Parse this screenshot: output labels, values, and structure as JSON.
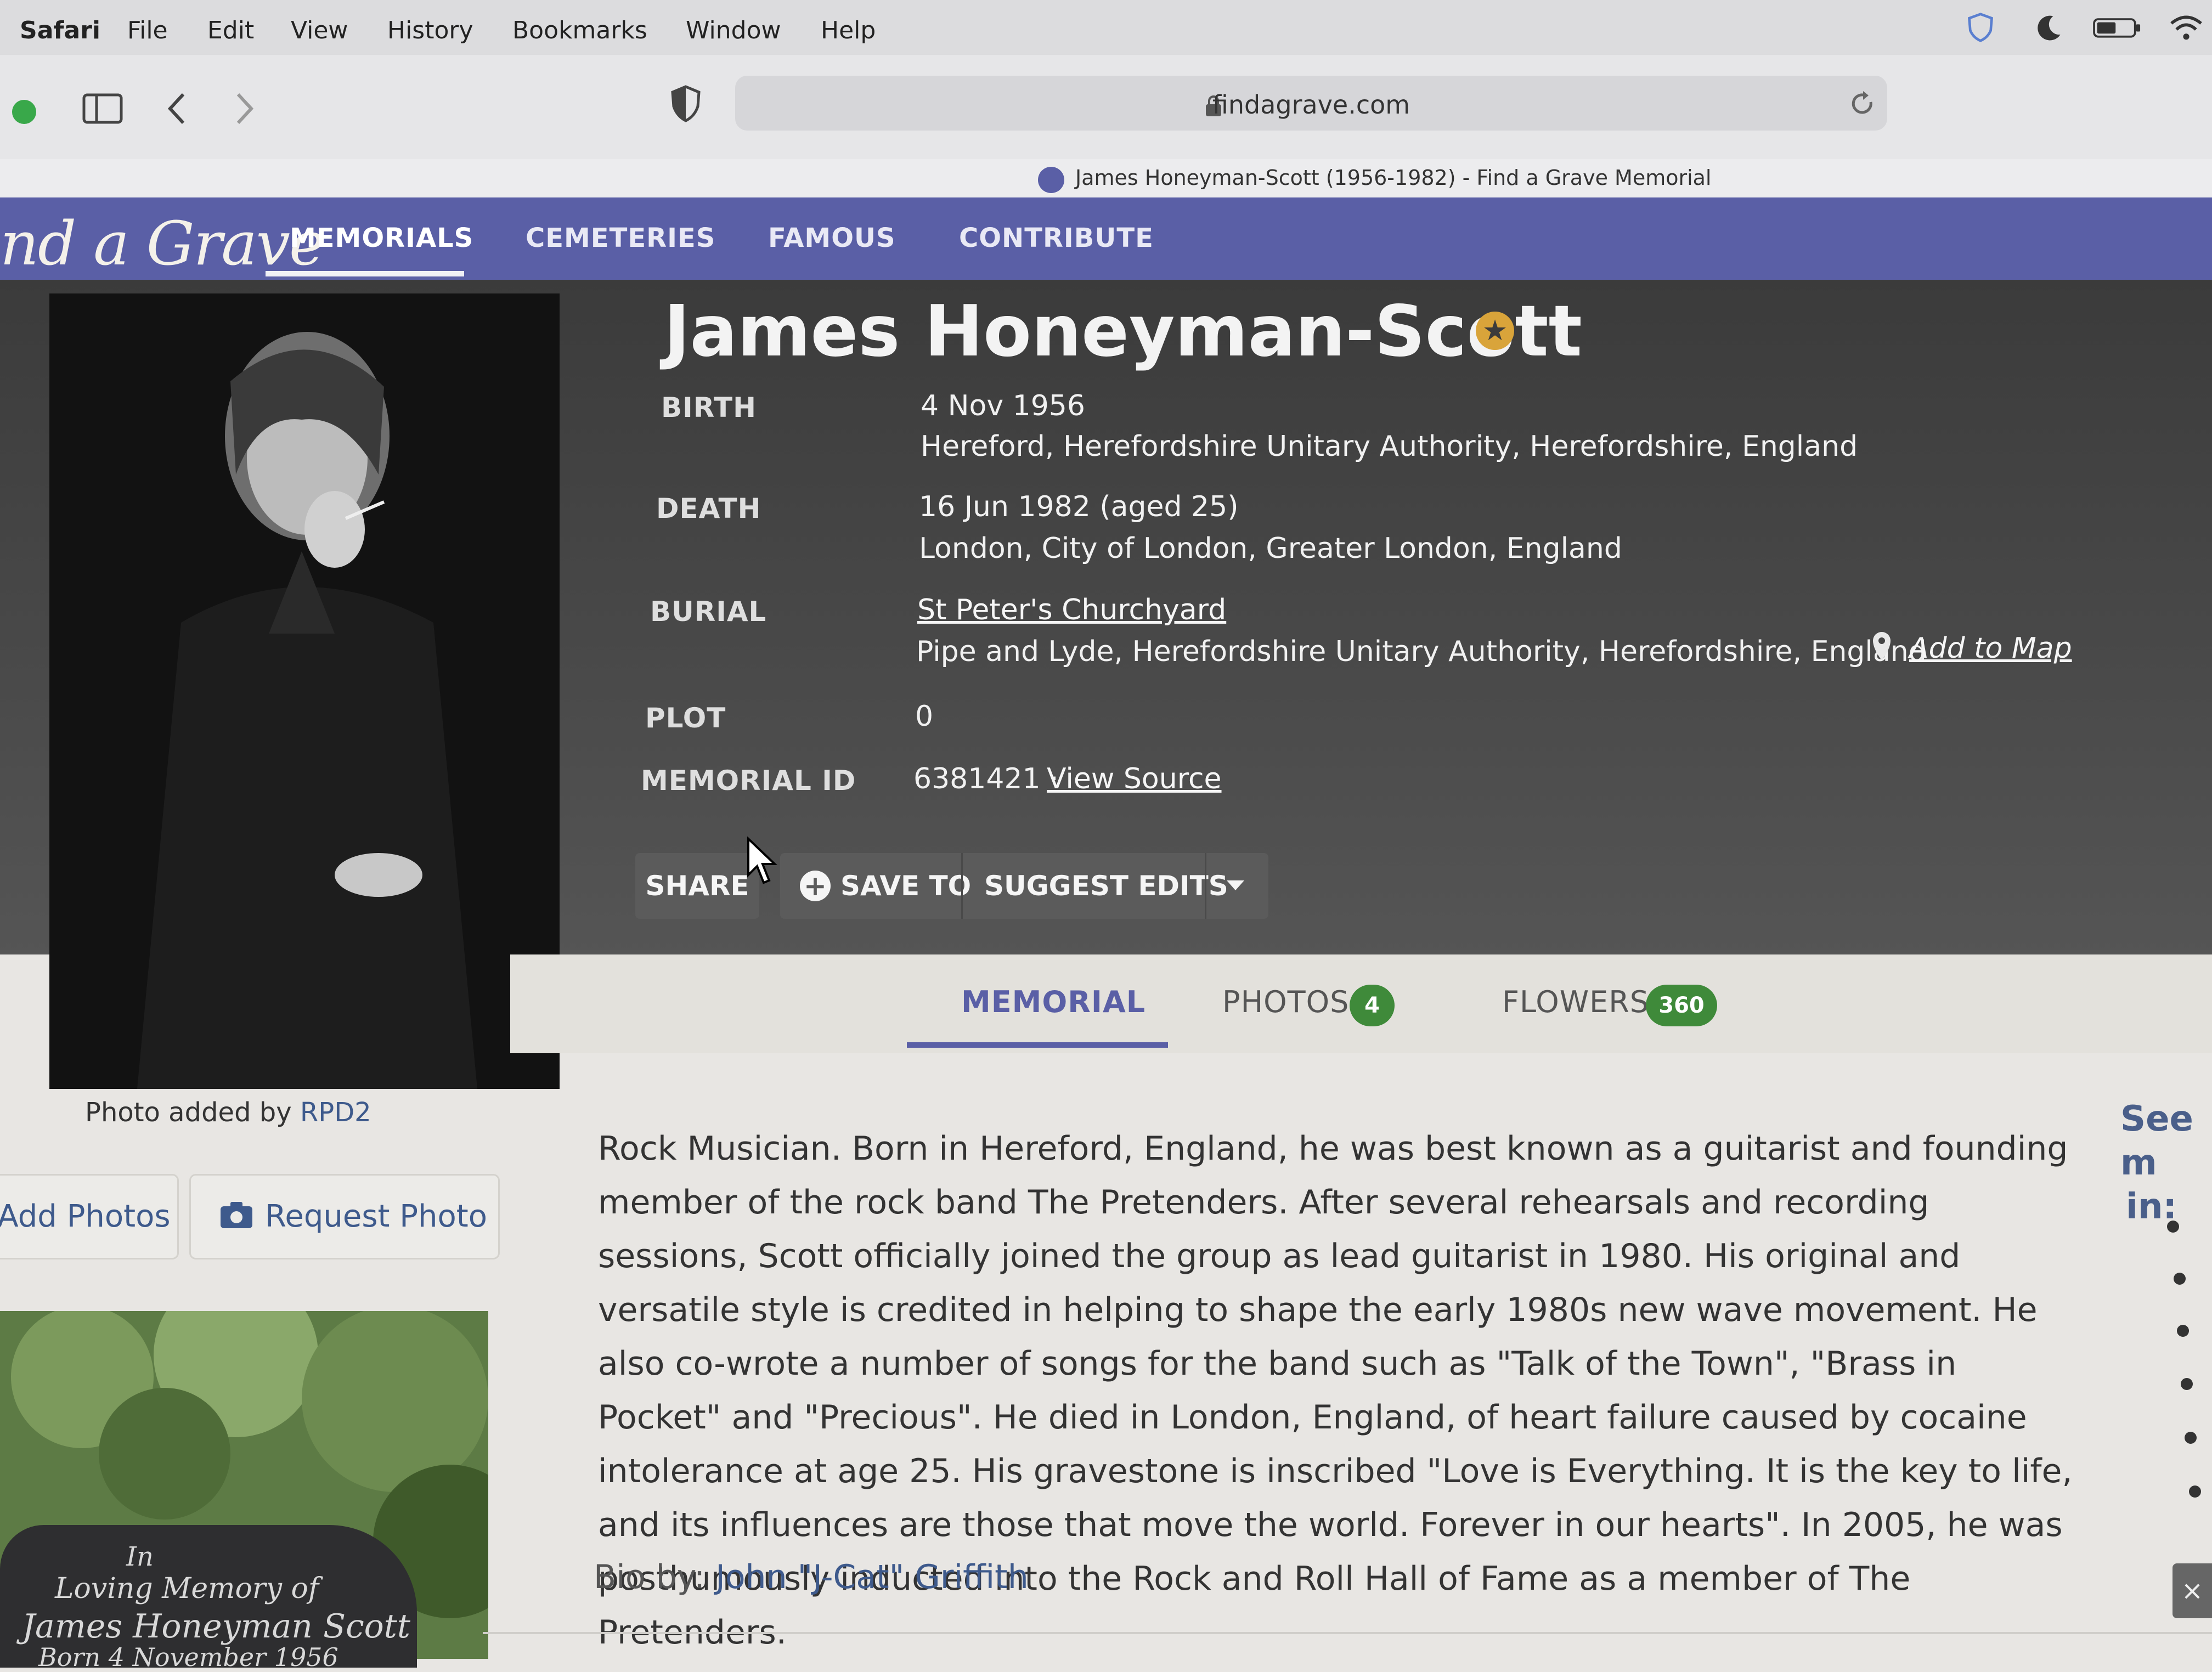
{
  "menubar": {
    "app": "Safari",
    "items": [
      "File",
      "Edit",
      "View",
      "History",
      "Bookmarks",
      "Window",
      "Help"
    ]
  },
  "browser": {
    "url": "findagrave.com",
    "tab_title": "James Honeyman-Scott (1956-1982) - Find a Grave Memorial"
  },
  "site": {
    "logo": "nd a Grave",
    "nav": [
      "MEMORIALS",
      "CEMETERIES",
      "FAMOUS",
      "CONTRIBUTE"
    ],
    "active_nav": "MEMORIALS"
  },
  "memorial": {
    "name": "James Honeyman-Scott",
    "birth_label": "BIRTH",
    "birth_date": "4 Nov 1956",
    "birth_place": "Hereford, Herefordshire Unitary Authority, Herefordshire, England",
    "death_label": "DEATH",
    "death_date": "16 Jun 1982 (aged 25)",
    "death_place": "London, City of London, Greater London, England",
    "burial_label": "BURIAL",
    "burial_cemetery": "St Peter's Churchyard",
    "burial_place": "Pipe and Lyde, Herefordshire Unitary Authority, Herefordshire, England",
    "add_to_map": "Add to Map",
    "plot_label": "PLOT",
    "plot": "0",
    "memorial_id_label": "MEMORIAL ID",
    "memorial_id": "6381421 ·",
    "view_source": "View Source"
  },
  "actions": {
    "share": "SHARE",
    "save_to": "SAVE TO",
    "suggest_edits": "SUGGEST EDITS"
  },
  "tabs": {
    "memorial": "MEMORIAL",
    "photos": "PHOTOS",
    "photos_count": "4",
    "flowers": "FLOWERS",
    "flowers_count": "360"
  },
  "photo_panel": {
    "added_by_prefix": "Photo added by ",
    "added_by_user": "RPD2",
    "add_photos": "Add Photos",
    "request_photo": "Request Photo"
  },
  "headstone": {
    "line1": "In",
    "line2": "Loving Memory of",
    "line3": "James Honeyman Scott",
    "line4": "Born 4 November 1956"
  },
  "bio": {
    "text": "Rock Musician. Born in Hereford, England, he was best known as a guitarist and founding member of the rock band The Pretenders. After several rehearsals and recording sessions, Scott officially joined the group as lead guitarist in 1980. His original and versatile style is credited in helping to shape the early 1980s new wave movement. He also co-wrote a number of songs for the band such as \"Talk of the Town\", \"Brass in Pocket\" and \"Precious\". He died in London, England, of heart failure caused by cocaine intolerance at age 25. His gravestone is inscribed \"Love is Everything. It is the key to life, and its influences are those that move the world. Forever in our hearts\". In 2005, he was posthumously inducted into the Rock and Roll Hall of Fame as a member of The Pretenders.",
    "by_prefix": "Bio by: ",
    "by_author": "John \"J-Cat\" Griffith"
  },
  "sidebar": {
    "see_more": "See m",
    "in_label": "in:"
  },
  "colors": {
    "nav_bg": "#5a5fa6",
    "hero_bg": "#444444",
    "badge_green": "#3f8a3a",
    "famous_star": "#d9a43a",
    "link_blue": "#3e5a8c"
  }
}
